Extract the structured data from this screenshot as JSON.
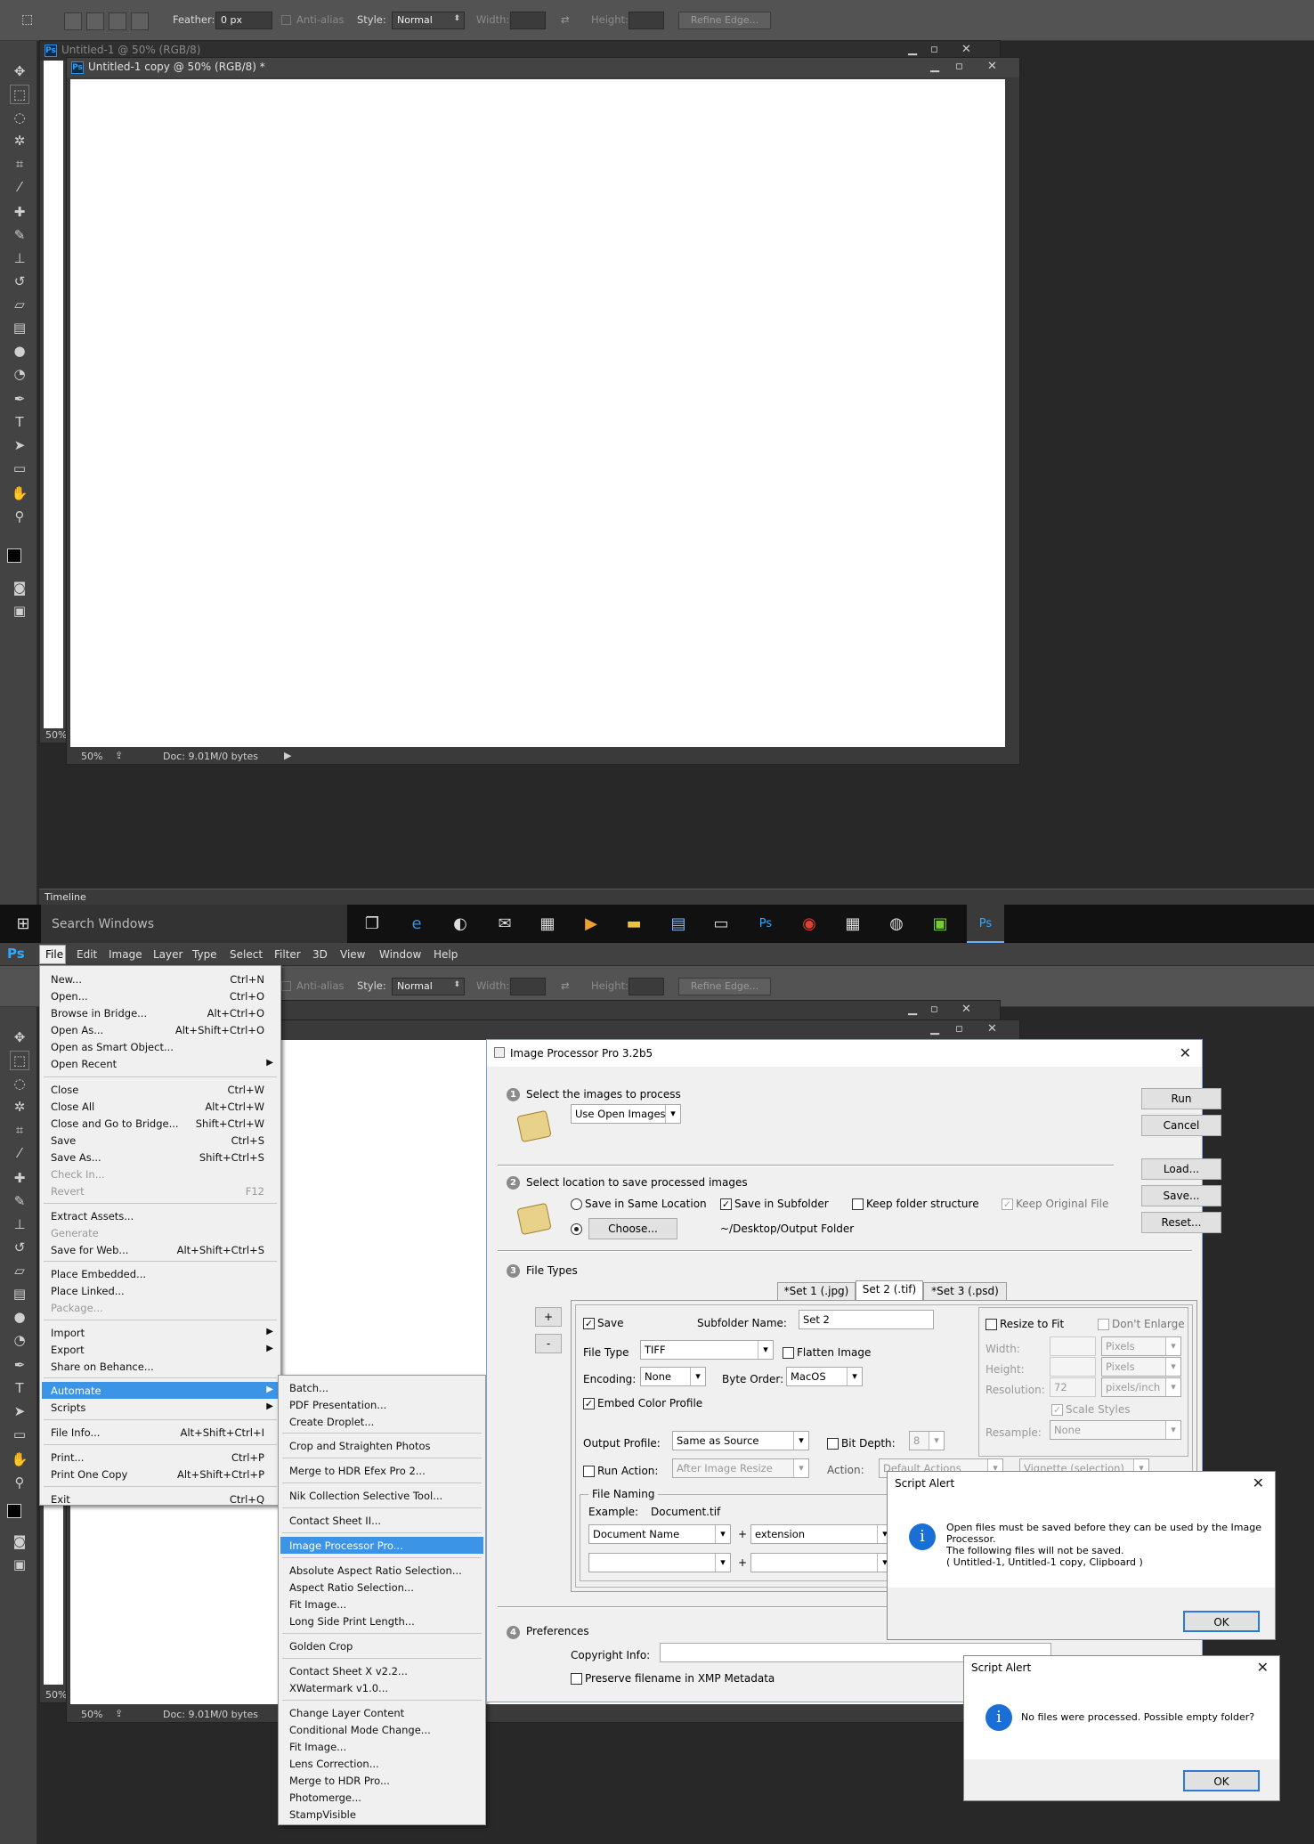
{
  "options": {
    "feather_label": "Feather:",
    "feather_value": "0 px",
    "antialias": "Anti-alias",
    "style_label": "Style:",
    "style_value": "Normal",
    "width_label": "Width:",
    "height_label": "Height:",
    "refine": "Refine Edge..."
  },
  "doc1": {
    "title": "Untitled-1 @ 50% (RGB/8)",
    "zoom": "50%"
  },
  "doc2": {
    "title": "Untitled-1 copy @ 50% (RGB/8) *",
    "zoom": "50%",
    "docinfo": "Doc: 9.01M/0 bytes"
  },
  "timeline": "Timeline",
  "taskbar": {
    "search": "Search Windows"
  },
  "menubar": [
    "File",
    "Edit",
    "Image",
    "Layer",
    "Type",
    "Select",
    "Filter",
    "3D",
    "View",
    "Window",
    "Help"
  ],
  "file_menu": [
    {
      "l": "New...",
      "s": "Ctrl+N"
    },
    {
      "l": "Open...",
      "s": "Ctrl+O"
    },
    {
      "l": "Browse in Bridge...",
      "s": "Alt+Ctrl+O"
    },
    {
      "l": "Open As...",
      "s": "Alt+Shift+Ctrl+O"
    },
    {
      "l": "Open as Smart Object...",
      "s": ""
    },
    {
      "l": "Open Recent",
      "s": ""
    },
    {
      "l": "Close",
      "s": "Ctrl+W"
    },
    {
      "l": "Close All",
      "s": "Alt+Ctrl+W"
    },
    {
      "l": "Close and Go to Bridge...",
      "s": "Shift+Ctrl+W"
    },
    {
      "l": "Save",
      "s": "Ctrl+S"
    },
    {
      "l": "Save As...",
      "s": "Shift+Ctrl+S"
    },
    {
      "l": "Check In...",
      "s": ""
    },
    {
      "l": "Revert",
      "s": "F12"
    },
    {
      "l": "Extract Assets...",
      "s": ""
    },
    {
      "l": "Generate",
      "s": ""
    },
    {
      "l": "Save for Web...",
      "s": "Alt+Shift+Ctrl+S"
    },
    {
      "l": "Place Embedded...",
      "s": ""
    },
    {
      "l": "Place Linked...",
      "s": ""
    },
    {
      "l": "Package...",
      "s": ""
    },
    {
      "l": "Import",
      "s": ""
    },
    {
      "l": "Export",
      "s": ""
    },
    {
      "l": "Share on Behance...",
      "s": ""
    },
    {
      "l": "Automate",
      "s": ""
    },
    {
      "l": "Scripts",
      "s": ""
    },
    {
      "l": "File Info...",
      "s": "Alt+Shift+Ctrl+I"
    },
    {
      "l": "Print...",
      "s": "Ctrl+P"
    },
    {
      "l": "Print One Copy",
      "s": "Alt+Shift+Ctrl+P"
    },
    {
      "l": "Exit",
      "s": "Ctrl+Q"
    }
  ],
  "automate_menu": [
    "Batch...",
    "PDF Presentation...",
    "Create Droplet...",
    "Crop and Straighten Photos",
    "Merge to HDR Efex Pro 2...",
    "Nik Collection Selective Tool...",
    "Contact Sheet II...",
    "Image Processor Pro...",
    "Absolute Aspect Ratio Selection...",
    "Aspect Ratio Selection...",
    "Fit Image...",
    "Long Side Print Length...",
    "Golden Crop",
    "Contact Sheet X v2.2...",
    "XWatermark v1.0...",
    "Change Layer Content",
    "Conditional Mode Change...",
    "Fit Image...",
    "Lens Correction...",
    "Merge to HDR Pro...",
    "Photomerge...",
    "StampVisible"
  ],
  "ipp": {
    "title": "Image Processor Pro 3.2b5",
    "s1": "Select the images to process",
    "s1_sel": "Use Open Images",
    "s2": "Select location to save processed images",
    "same": "Save in Same Location",
    "subf": "Save in Subfolder",
    "keep": "Keep folder structure",
    "orig": "Keep Original File",
    "choose": "Choose...",
    "path": "~/Desktop/Output Folder",
    "s3": "File Types",
    "tabs": [
      "*Set 1 (.jpg)",
      "Set 2 (.tif)",
      "*Set 3 (.psd)"
    ],
    "plus": "+",
    "minus": "-",
    "save": "Save",
    "subname_label": "Subfolder Name:",
    "subname": "Set 2",
    "ftype_label": "File Type",
    "ftype": "TIFF",
    "flatten": "Flatten Image",
    "enc_label": "Encoding:",
    "enc": "None",
    "bo_label": "Byte Order:",
    "bo": "MacOS",
    "embed": "Embed Color Profile",
    "op_label": "Output Profile:",
    "op": "Same as Source",
    "bitd": "Bit Depth:",
    "bitv": "8",
    "runact": "Run Action:",
    "after": "After Image Resize",
    "action": "Action:",
    "defacts": "Default Actions",
    "vign": "Vignette (selection)",
    "fname": "File Naming",
    "example_label": "Example:",
    "example": "Document.tif",
    "docname": "Document Name",
    "ext": "extension",
    "resize": "Resize to Fit",
    "dont": "Don't Enlarge",
    "w": "Width:",
    "h": "Height:",
    "res": "Resolution:",
    "resv": "72",
    "px": "Pixels",
    "ppi": "pixels/inch",
    "scale": "Scale Styles",
    "resample": "Resample:",
    "rsv": "None",
    "s4": "Preferences",
    "copy": "Copyright Info:",
    "preserve": "Preserve filename in XMP Metadata",
    "run": "Run",
    "cancel": "Cancel",
    "load": "Load...",
    "savebtn": "Save...",
    "reset": "Reset..."
  },
  "alert1": {
    "title": "Script Alert",
    "l1": "Open files must be saved before they can be used by the Image",
    "l2": "Processor.",
    "l3": "The following files will not be saved.",
    "l4": "( Untitled-1, Untitled-1 copy, Clipboard )",
    "ok": "OK"
  },
  "alert2": {
    "title": "Script Alert",
    "msg": "No files were processed. Possible empty folder?",
    "ok": "OK"
  }
}
